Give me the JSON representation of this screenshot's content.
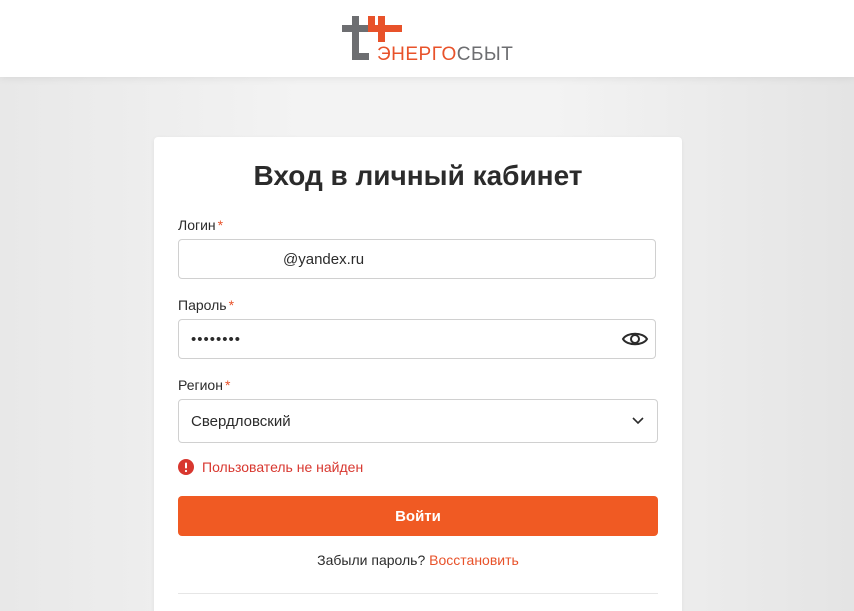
{
  "header": {
    "logo_text_primary": "ЭНЕРГО",
    "logo_text_secondary": "СБЫТ"
  },
  "login_form": {
    "title": "Вход в личный кабинет",
    "required_mark": "*",
    "login": {
      "label": "Логин",
      "value": "@yandex.ru"
    },
    "password": {
      "label": "Пароль",
      "value": "••••••••",
      "toggle_icon": "eye-icon"
    },
    "region": {
      "label": "Регион",
      "selected": "Свердловский",
      "icon": "chevron-down-icon"
    },
    "error": {
      "icon": "alert-circle-icon",
      "message": "Пользователь не найден"
    },
    "submit_label": "Войти",
    "forgot": {
      "prompt": "Забыли пароль?",
      "link": "Восстановить"
    }
  },
  "colors": {
    "brand": "#f05a23",
    "brand_text": "#e8522a",
    "logo_gray": "#6d6e71",
    "error": "#d8372f",
    "text": "#2b2b2b"
  }
}
